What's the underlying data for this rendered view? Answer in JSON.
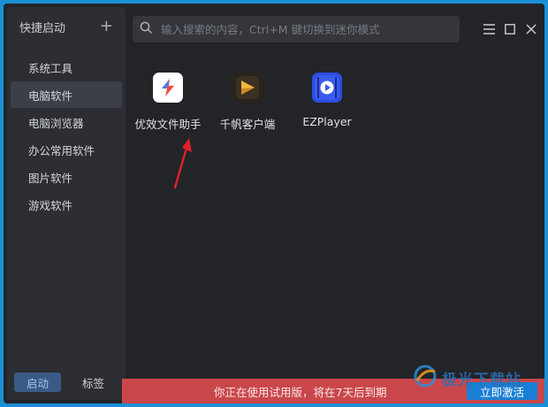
{
  "sidebar": {
    "title": "快捷启动",
    "add_icon": "plus-icon",
    "items": [
      {
        "label": "系统工具",
        "active": false
      },
      {
        "label": "电脑软件",
        "active": true
      },
      {
        "label": "电脑浏览器",
        "active": false
      },
      {
        "label": "办公常用软件",
        "active": false
      },
      {
        "label": "图片软件",
        "active": false
      },
      {
        "label": "游戏软件",
        "active": false
      }
    ],
    "footer": {
      "launch": "启动",
      "tags": "标签"
    }
  },
  "search": {
    "icon": "search-icon",
    "placeholder": "输入搜索的内容，Ctrl+M 键切换到迷你模式"
  },
  "window_controls": [
    "menu-icon",
    "maximize-icon",
    "close-icon"
  ],
  "apps": [
    {
      "label": "优效文件助手",
      "icon": "file-assistant-icon"
    },
    {
      "label": "千帆客户端",
      "icon": "qianfan-client-icon"
    },
    {
      "label": "EZPlayer",
      "icon": "ezplayer-icon"
    }
  ],
  "trial": {
    "message": "你正在使用试用版，将在7天后到期",
    "activate_label": "立即激活"
  },
  "colors": {
    "background": "#222428",
    "sidebar": "#2c2e33",
    "trial_bar": "#c9474b",
    "accent": "#1a7fd4",
    "arrow": "#e0202a"
  },
  "watermark": {
    "text": "极光下载站"
  }
}
